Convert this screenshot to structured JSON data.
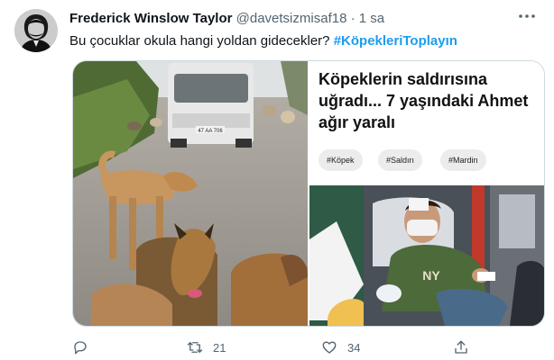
{
  "tweet": {
    "author_name": "Frederick Winslow Taylor",
    "handle": "@davetsizmisaf18",
    "separator": "·",
    "time": "1 sa",
    "text": "Bu çocuklar okula hangi yoldan gidecekler?",
    "hashtag": "#KöpekleriToplayın"
  },
  "media": {
    "headline": "Köpeklerin saldırısına uğradı... 7 yaşındaki Ahmet ağır yaralı",
    "tags": [
      "#Köpek",
      "#Saldırı",
      "#Mardin"
    ],
    "van_plate": "47 AA 706"
  },
  "actions": {
    "reply_count": "",
    "retweet_count": "21",
    "like_count": "34"
  },
  "colors": {
    "accent": "#1d9bf0",
    "muted": "#536471",
    "border": "#cfd9de"
  },
  "icons": [
    "more-icon",
    "reply-icon",
    "retweet-icon",
    "like-icon",
    "share-icon"
  ]
}
